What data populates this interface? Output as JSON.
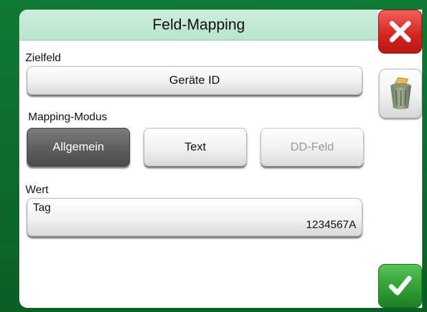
{
  "title": "Feld-Mapping",
  "target_field": {
    "label": "Zielfeld",
    "value": "Geräte ID"
  },
  "mapping_mode": {
    "label": "Mapping-Modus",
    "options": [
      {
        "label": "Allgemein",
        "state": "selected"
      },
      {
        "label": "Text",
        "state": "normal"
      },
      {
        "label": "DD-Feld",
        "state": "disabled"
      }
    ]
  },
  "value_field": {
    "label": "Wert",
    "name": "Tag",
    "value": "1234567A"
  },
  "side_buttons": {
    "close_icon": "close-x-icon",
    "delete_icon": "trash-can-icon",
    "confirm_icon": "checkmark-icon"
  },
  "colors": {
    "frame": "#0b6a2a",
    "titlebar": "#c3e9d3",
    "close": "#d4231f",
    "confirm": "#2e9c33",
    "selected_mode": "#5b5b5b"
  }
}
